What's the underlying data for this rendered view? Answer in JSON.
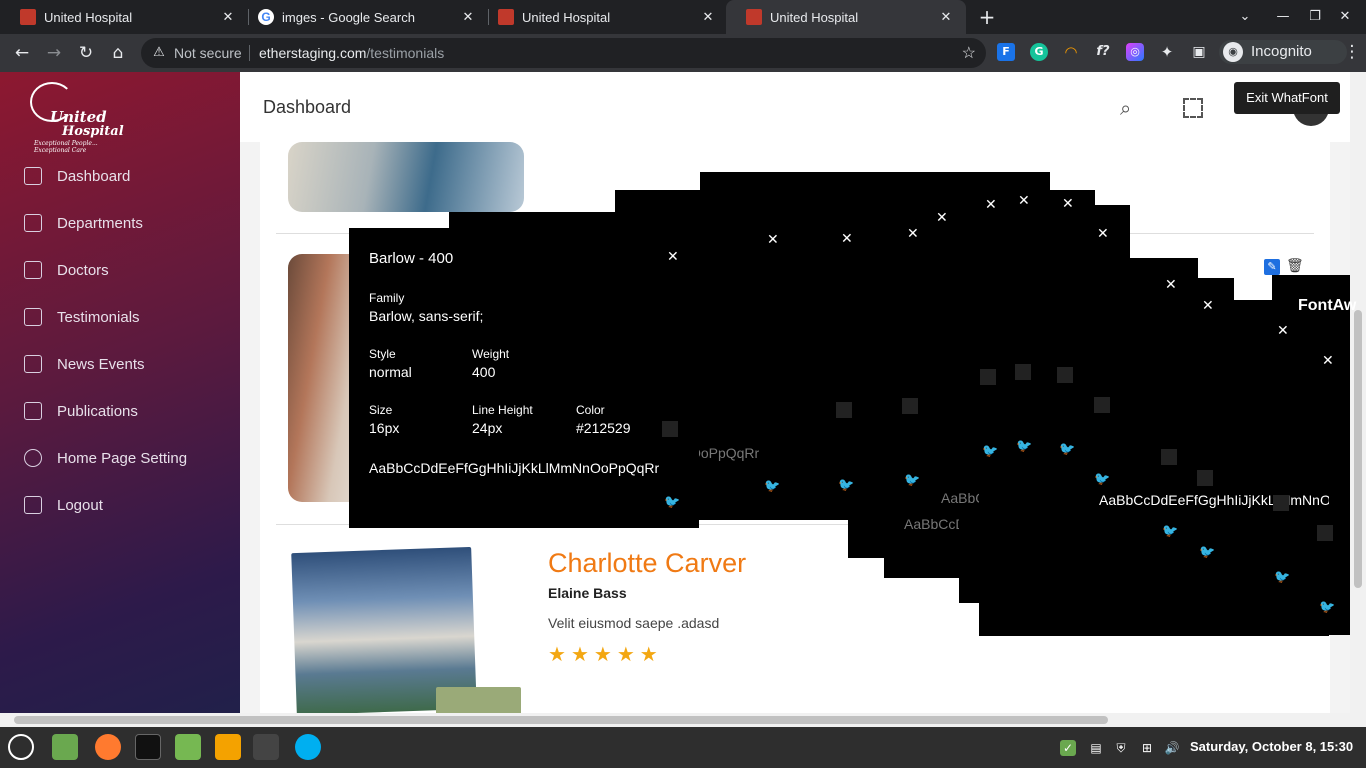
{
  "tabs": [
    {
      "title": "United Hospital",
      "active": false
    },
    {
      "title": "imges - Google Search",
      "active": false
    },
    {
      "title": "United Hospital",
      "active": false
    },
    {
      "title": "United Hospital",
      "active": true
    }
  ],
  "browser": {
    "security": "Not secure",
    "url_host": "etherstaging.com",
    "url_path": "/testimonials",
    "profile": "Incognito"
  },
  "sidebar": {
    "logo": {
      "line1": "United",
      "line2": "Hospital",
      "tagline": "Exceptional People... Exceptional Care"
    },
    "items": [
      {
        "label": "Dashboard",
        "icon": "monitor-icon"
      },
      {
        "label": "Departments",
        "icon": "briefcase-icon"
      },
      {
        "label": "Doctors",
        "icon": "briefcase-icon"
      },
      {
        "label": "Testimonials",
        "icon": "edit-icon"
      },
      {
        "label": "News Events",
        "icon": "document-icon"
      },
      {
        "label": "Publications",
        "icon": "document-icon"
      },
      {
        "label": "Home Page Setting",
        "icon": "gear-icon"
      },
      {
        "label": "Logout",
        "icon": "logout-icon"
      }
    ]
  },
  "header": {
    "title": "Dashboard"
  },
  "exit_whatfont": "Exit WhatFont",
  "testimonial": {
    "name": "Charlotte Carver",
    "role": "Elaine Bass",
    "text": "Velit eiusmod saepe .adasd",
    "rating": 5
  },
  "whatfont": {
    "title": "Barlow - 400",
    "family_label": "Family",
    "family": "Barlow, sans-serif;",
    "style_label": "Style",
    "style": "normal",
    "weight_label": "Weight",
    "weight": "400",
    "size_label": "Size",
    "size": "16px",
    "lineheight_label": "Line Height",
    "lineheight": "24px",
    "color_label": "Color",
    "color": "#212529",
    "sample": "AaBbCcDdEeFfGgHhIiJjKkLlMmNnOoPpQqRr",
    "partial_fontaw": "FontAw"
  },
  "taskbar": {
    "clock": "Saturday, October  8, 15:30"
  }
}
